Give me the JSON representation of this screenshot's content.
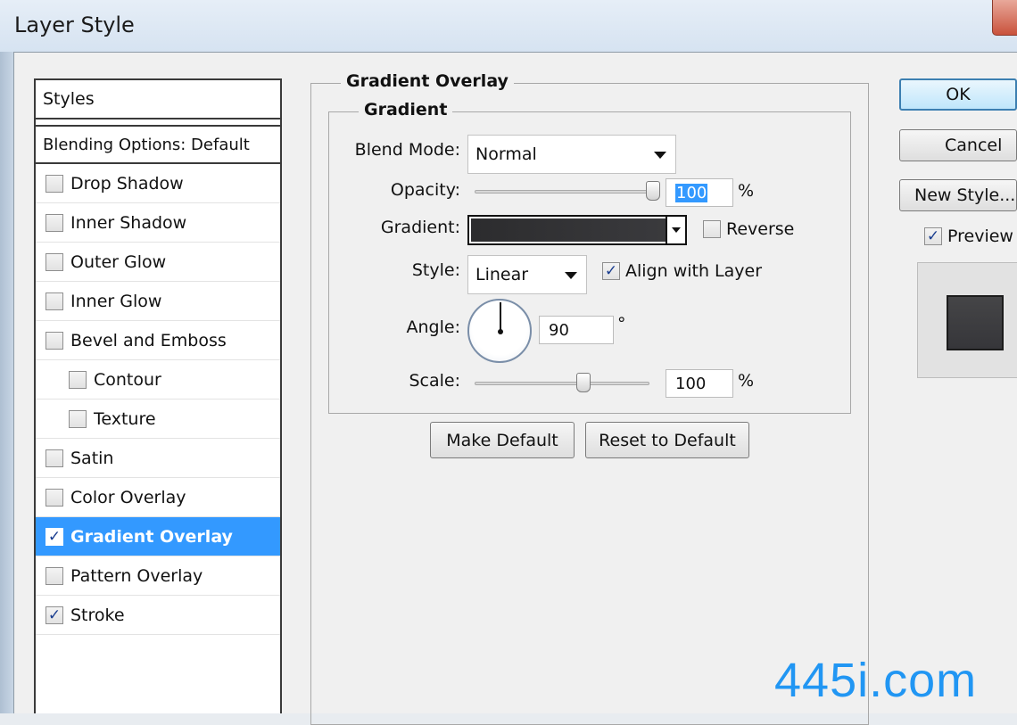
{
  "window": {
    "title": "Layer Style"
  },
  "styles_panel": {
    "header": "Styles",
    "blending_options": "Blending Options: Default",
    "items": [
      {
        "label": "Drop Shadow",
        "checked": false,
        "indent": false,
        "selected": false
      },
      {
        "label": "Inner Shadow",
        "checked": false,
        "indent": false,
        "selected": false
      },
      {
        "label": "Outer Glow",
        "checked": false,
        "indent": false,
        "selected": false
      },
      {
        "label": "Inner Glow",
        "checked": false,
        "indent": false,
        "selected": false
      },
      {
        "label": "Bevel and Emboss",
        "checked": false,
        "indent": false,
        "selected": false
      },
      {
        "label": "Contour",
        "checked": false,
        "indent": true,
        "selected": false
      },
      {
        "label": "Texture",
        "checked": false,
        "indent": true,
        "selected": false
      },
      {
        "label": "Satin",
        "checked": false,
        "indent": false,
        "selected": false
      },
      {
        "label": "Color Overlay",
        "checked": false,
        "indent": false,
        "selected": false
      },
      {
        "label": "Gradient Overlay",
        "checked": true,
        "indent": false,
        "selected": true
      },
      {
        "label": "Pattern Overlay",
        "checked": false,
        "indent": false,
        "selected": false
      },
      {
        "label": "Stroke",
        "checked": true,
        "indent": false,
        "selected": false
      }
    ]
  },
  "gradient_overlay": {
    "title": "Gradient Overlay",
    "subgroup": "Gradient",
    "blend_mode": {
      "label": "Blend Mode:",
      "value": "Normal"
    },
    "opacity": {
      "label": "Opacity:",
      "value": "100",
      "unit": "%",
      "level": 1.0
    },
    "gradient": {
      "label": "Gradient:",
      "colors": [
        "#2c2c2e",
        "#3a3a3d"
      ]
    },
    "reverse": {
      "label": "Reverse",
      "checked": false
    },
    "style": {
      "label": "Style:",
      "value": "Linear"
    },
    "align_with_layer": {
      "label": "Align with Layer",
      "checked": true
    },
    "angle": {
      "label": "Angle:",
      "value": "90",
      "unit": "°"
    },
    "scale": {
      "label": "Scale:",
      "value": "100",
      "unit": "%",
      "level": 0.62
    },
    "make_default": "Make Default",
    "reset_to_default": "Reset to Default"
  },
  "actions": {
    "ok": "OK",
    "cancel": "Cancel",
    "new_style": "New Style...",
    "preview": {
      "label": "Preview",
      "checked": true
    }
  },
  "watermark": "445i.com",
  "check_glyph": "✓"
}
